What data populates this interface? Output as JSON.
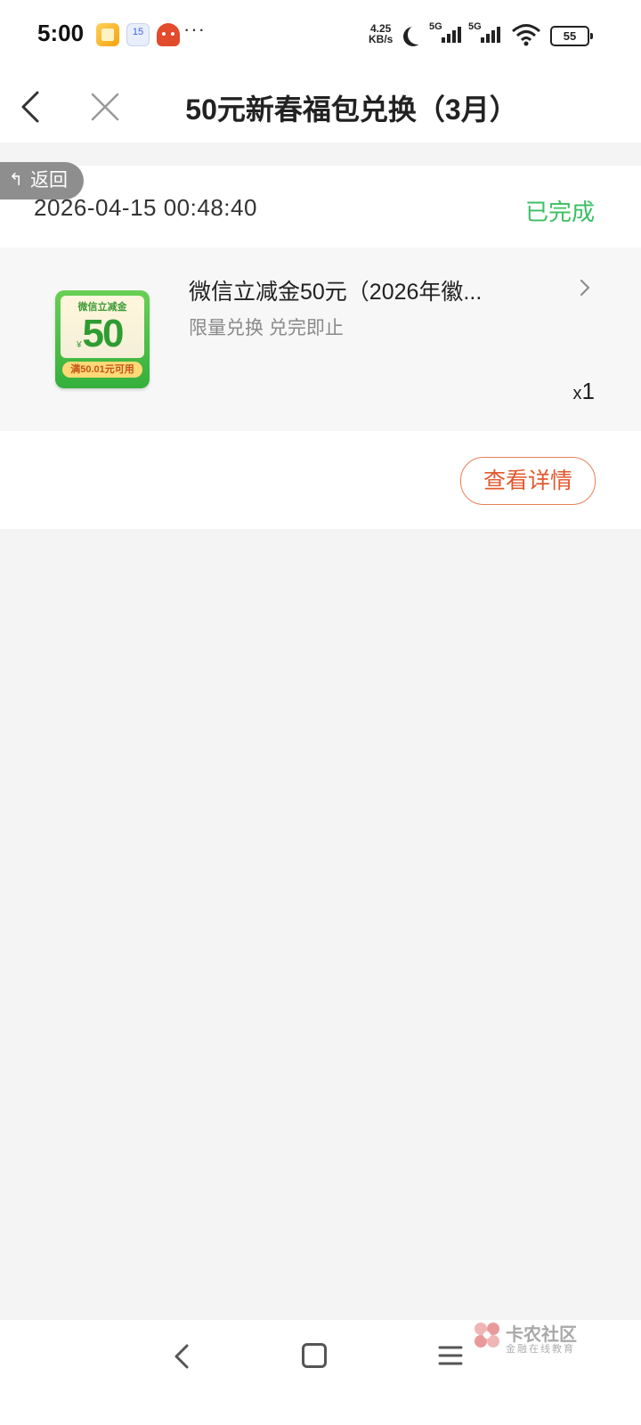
{
  "status_bar": {
    "time": "5:00",
    "calendar_day": "15",
    "dots": "···",
    "net_speed_value": "4.25",
    "net_speed_unit": "KB/s",
    "sim1": "5G",
    "sim2": "5G",
    "battery": "55",
    "icons": [
      "notes-app-icon",
      "calendar-app-icon",
      "robot-app-icon",
      "moon-icon",
      "signal-icon",
      "wifi-icon",
      "battery-icon"
    ]
  },
  "nav": {
    "title": "50元新春福包兑换（3月）",
    "back_icon": "chevron-left-icon",
    "close_icon": "close-icon"
  },
  "back_pill": {
    "label": "返回",
    "icon": "reply-arrow-icon"
  },
  "order": {
    "time": "2026-04-15 00:48:40",
    "status": "已完成",
    "status_color": "#3bbf63"
  },
  "item": {
    "name": "微信立减金50元（2026年徽...",
    "sub": "限量兑换 兑完即止",
    "qty_prefix": "x",
    "qty": "1",
    "coupon": {
      "title": "微信立减金",
      "currency": "¥",
      "amount": "50",
      "condition": "满50.01元可用"
    }
  },
  "actions": {
    "detail_label": "查看详情",
    "accent_color": "#e2582e"
  },
  "system_nav": {
    "icons": [
      "back-icon",
      "home-icon",
      "menu-icon"
    ]
  },
  "watermark": {
    "title": "卡农社区",
    "subtitle": "金融在线教育"
  }
}
